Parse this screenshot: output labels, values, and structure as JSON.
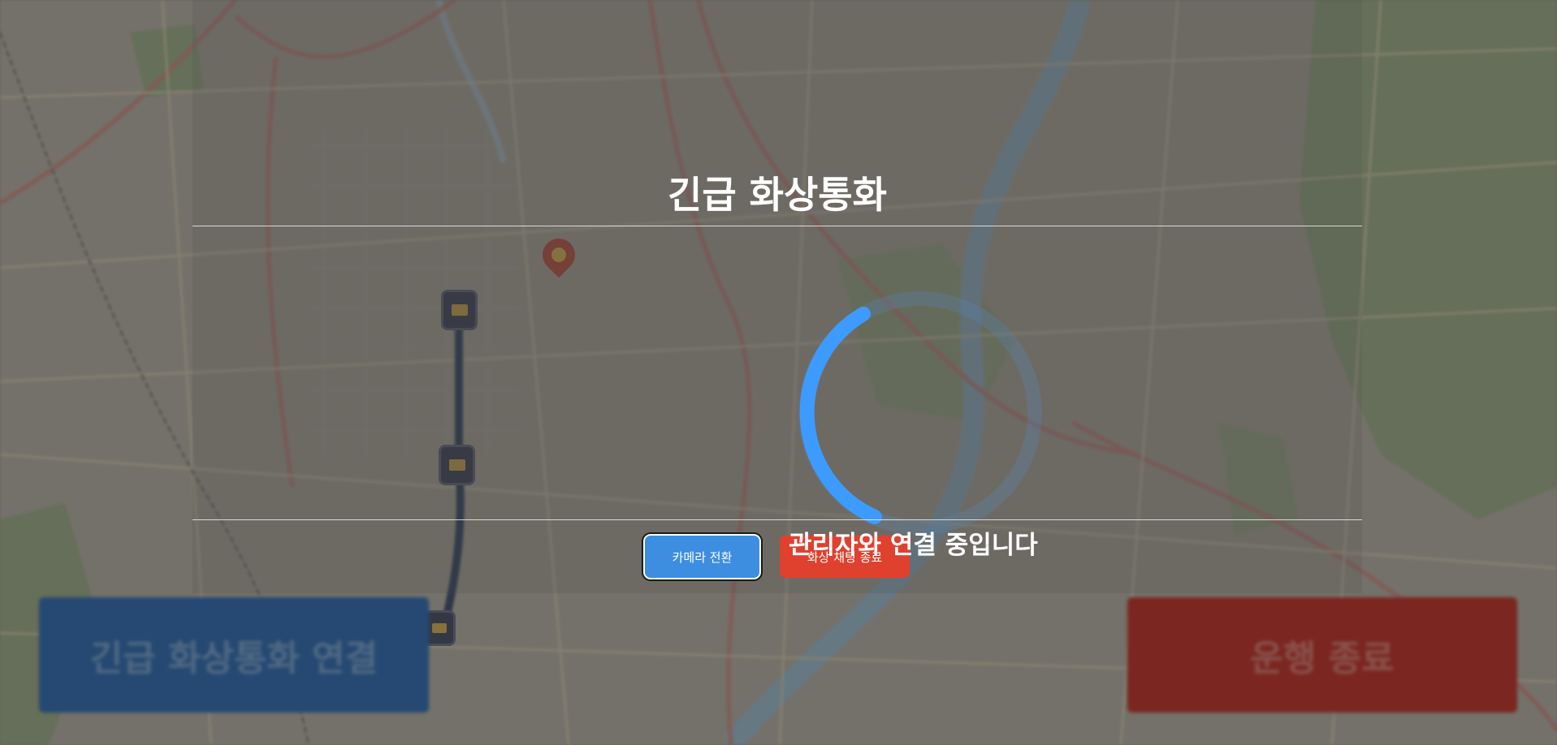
{
  "background": {
    "left_button_label": "긴급 화상통화 연결",
    "right_button_label": "운행 종료",
    "colors": {
      "left_button": "#1f5fa7",
      "right_button": "#b3231a"
    }
  },
  "modal": {
    "title": "긴급 화상통화",
    "status_text": "관리자와 연결 중입니다",
    "spinner_icon": "loading-spinner-icon",
    "buttons": {
      "switch_camera": "카메라 전환",
      "end_video_chat": "화상 채팅 종료"
    },
    "colors": {
      "spinner": "#3d9bff",
      "switch_camera": "#3d8ee0",
      "end_video_chat": "#e0402e"
    }
  },
  "map": {
    "marker_icons": [
      "bus-marker-icon",
      "bus-marker-icon",
      "bus-marker-icon",
      "location-pin-icon"
    ]
  }
}
